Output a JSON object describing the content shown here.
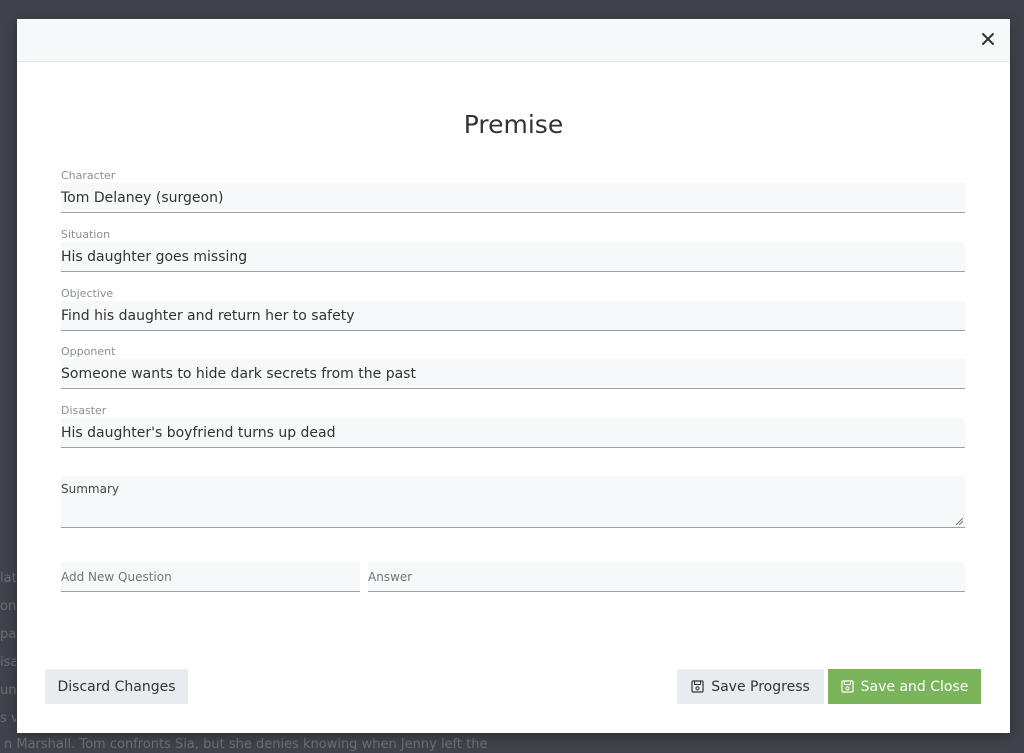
{
  "background": {
    "side_fragments": [
      "lat",
      "ons",
      "pa",
      "isa",
      "un",
      "s v"
    ],
    "bottom_text": "n Marshall. Tom confronts Sia, but she denies knowing when Jenny left the"
  },
  "modal": {
    "title": "Premise",
    "close_icon": "close-icon",
    "fields": [
      {
        "label": "Character",
        "value": "Tom Delaney (surgeon)"
      },
      {
        "label": "Situation",
        "value": "His daughter goes missing"
      },
      {
        "label": "Objective",
        "value": "Find his daughter and return her to safety"
      },
      {
        "label": "Opponent",
        "value": "Someone wants to hide dark secrets from the past"
      },
      {
        "label": "Disaster",
        "value": "His daughter's boyfriend turns up dead"
      }
    ],
    "summary": {
      "label": "Summary",
      "value": ""
    },
    "new_question": {
      "placeholder": "Add New Question",
      "answer_placeholder": "Answer"
    },
    "buttons": {
      "discard": "Discard Changes",
      "save_progress": "Save Progress",
      "save_close": "Save and Close"
    }
  },
  "colors": {
    "accent_green": "#7ab55c",
    "button_light": "#e8ecf0",
    "overlay": "#3d4047"
  }
}
